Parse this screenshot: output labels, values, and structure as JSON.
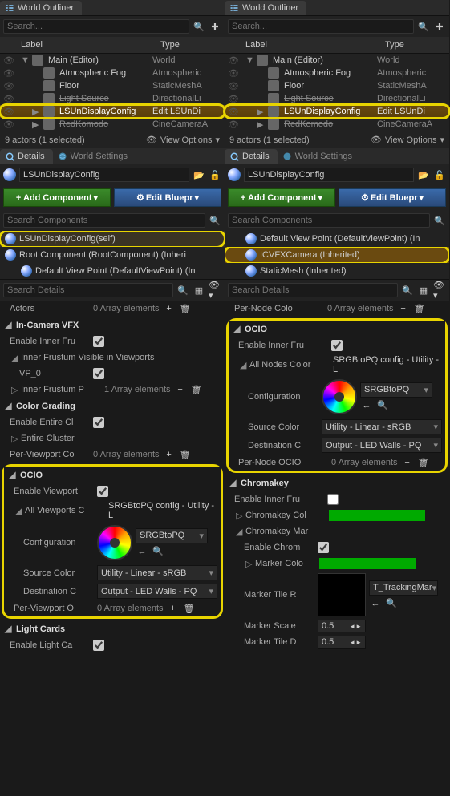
{
  "search_placeholder": "Search...",
  "search_details_placeholder": "Search Details",
  "search_components_placeholder": "Search Components",
  "outliner": {
    "tab": "World Outliner",
    "header_label": "Label",
    "header_type": "Type",
    "status": "9 actors (1 selected)",
    "view_options": "View Options",
    "items": [
      {
        "label": "Main (Editor)",
        "type": "World",
        "indent": 0,
        "arrow": "▼",
        "struck": false
      },
      {
        "label": "Atmospheric Fog",
        "type": "Atmospheric",
        "indent": 1,
        "arrow": "",
        "struck": false
      },
      {
        "label": "Floor",
        "type": "StaticMeshA",
        "indent": 1,
        "arrow": "",
        "struck": false
      },
      {
        "label": "Light Source",
        "type": "DirectionalLi",
        "indent": 1,
        "arrow": "",
        "struck": true
      },
      {
        "label": "LSUnDisplayConfig",
        "type": "Edit LSUnDi",
        "indent": 1,
        "arrow": "▶",
        "struck": false,
        "sel": true,
        "ring": true
      },
      {
        "label": "RedKomodo",
        "type": "CineCameraA",
        "indent": 1,
        "arrow": "▶",
        "struck": true
      }
    ]
  },
  "details": {
    "tab_details": "Details",
    "tab_world": "World Settings",
    "actor_name": "LSUnDisplayConfig",
    "add_component": "+ Add Component",
    "edit_blueprint": "Edit Bluepr"
  },
  "left_components": [
    {
      "label": "LSUnDisplayConfig(self)",
      "root": true,
      "ring": true
    },
    {
      "label": "Root Component (RootComponent) (Inheri"
    },
    {
      "label": "Default View Point (DefaultViewPoint) (In",
      "indent": true
    }
  ],
  "right_components": [
    {
      "label": "Default View Point (DefaultViewPoint) (In",
      "indent": true
    },
    {
      "label": "ICVFXCamera (Inherited)",
      "hl": true,
      "ring": true,
      "indent": true
    },
    {
      "label": "StaticMesh (Inherited)",
      "indent": true
    }
  ],
  "props_left_top": {
    "actors_label": "Actors",
    "actors_val": "0 Array elements",
    "incamera_title": "In-Camera VFX",
    "enable_inner": "Enable Inner Fru",
    "inner_visible": "Inner Frustum Visible in Viewports",
    "vp0": "VP_0",
    "inner_array": "Inner Frustum P",
    "inner_array_val": "1 Array elements",
    "colorgrading_title": "Color Grading",
    "enable_entire": "Enable Entire Cl",
    "entire_cluster": "Entire Cluster",
    "per_viewport": "Per-Viewport Co",
    "per_viewport_val": "0 Array elements"
  },
  "ocio_left": {
    "title": "OCIO",
    "enable": "Enable Viewport",
    "all_viewports": "All Viewports C",
    "all_viewports_val": "SRGBtoPQ config - Utility - L",
    "config": "Configuration",
    "config_val": "SRGBtoPQ",
    "source": "Source Color",
    "source_val": "Utility - Linear - sRGB",
    "dest": "Destination C",
    "dest_val": "Output - LED Walls - PQ",
    "per": "Per-Viewport O",
    "per_val": "0 Array elements"
  },
  "light_cards": {
    "title": "Light Cards",
    "enable": "Enable Light Ca"
  },
  "props_right_top": {
    "per_node": "Per-Node Colo",
    "per_node_val": "0 Array elements"
  },
  "ocio_right": {
    "title": "OCIO",
    "enable": "Enable Inner Fru",
    "all_nodes": "All Nodes Color",
    "all_nodes_val": "SRGBtoPQ config - Utility - L",
    "config": "Configuration",
    "config_val": "SRGBtoPQ",
    "source": "Source Color",
    "source_val": "Utility - Linear - sRGB",
    "dest": "Destination C",
    "dest_val": "Output - LED Walls - PQ",
    "per": "Per-Node OCIO",
    "per_val": "0 Array elements"
  },
  "chroma": {
    "title": "Chromakey",
    "enable_inner": "Enable Inner Fru",
    "chromakey_col": "Chromakey Col",
    "chromakey_mar": "Chromakey Mar",
    "enable_chrom": "Enable Chrom",
    "marker_col": "Marker Colo",
    "marker_tile": "Marker Tile R",
    "marker_tile_val": "T_TrackingMar",
    "marker_scale": "Marker Scale",
    "marker_scale_val": "0.5",
    "marker_tile_d": "Marker Tile D",
    "marker_tile_d_val": "0.5"
  }
}
